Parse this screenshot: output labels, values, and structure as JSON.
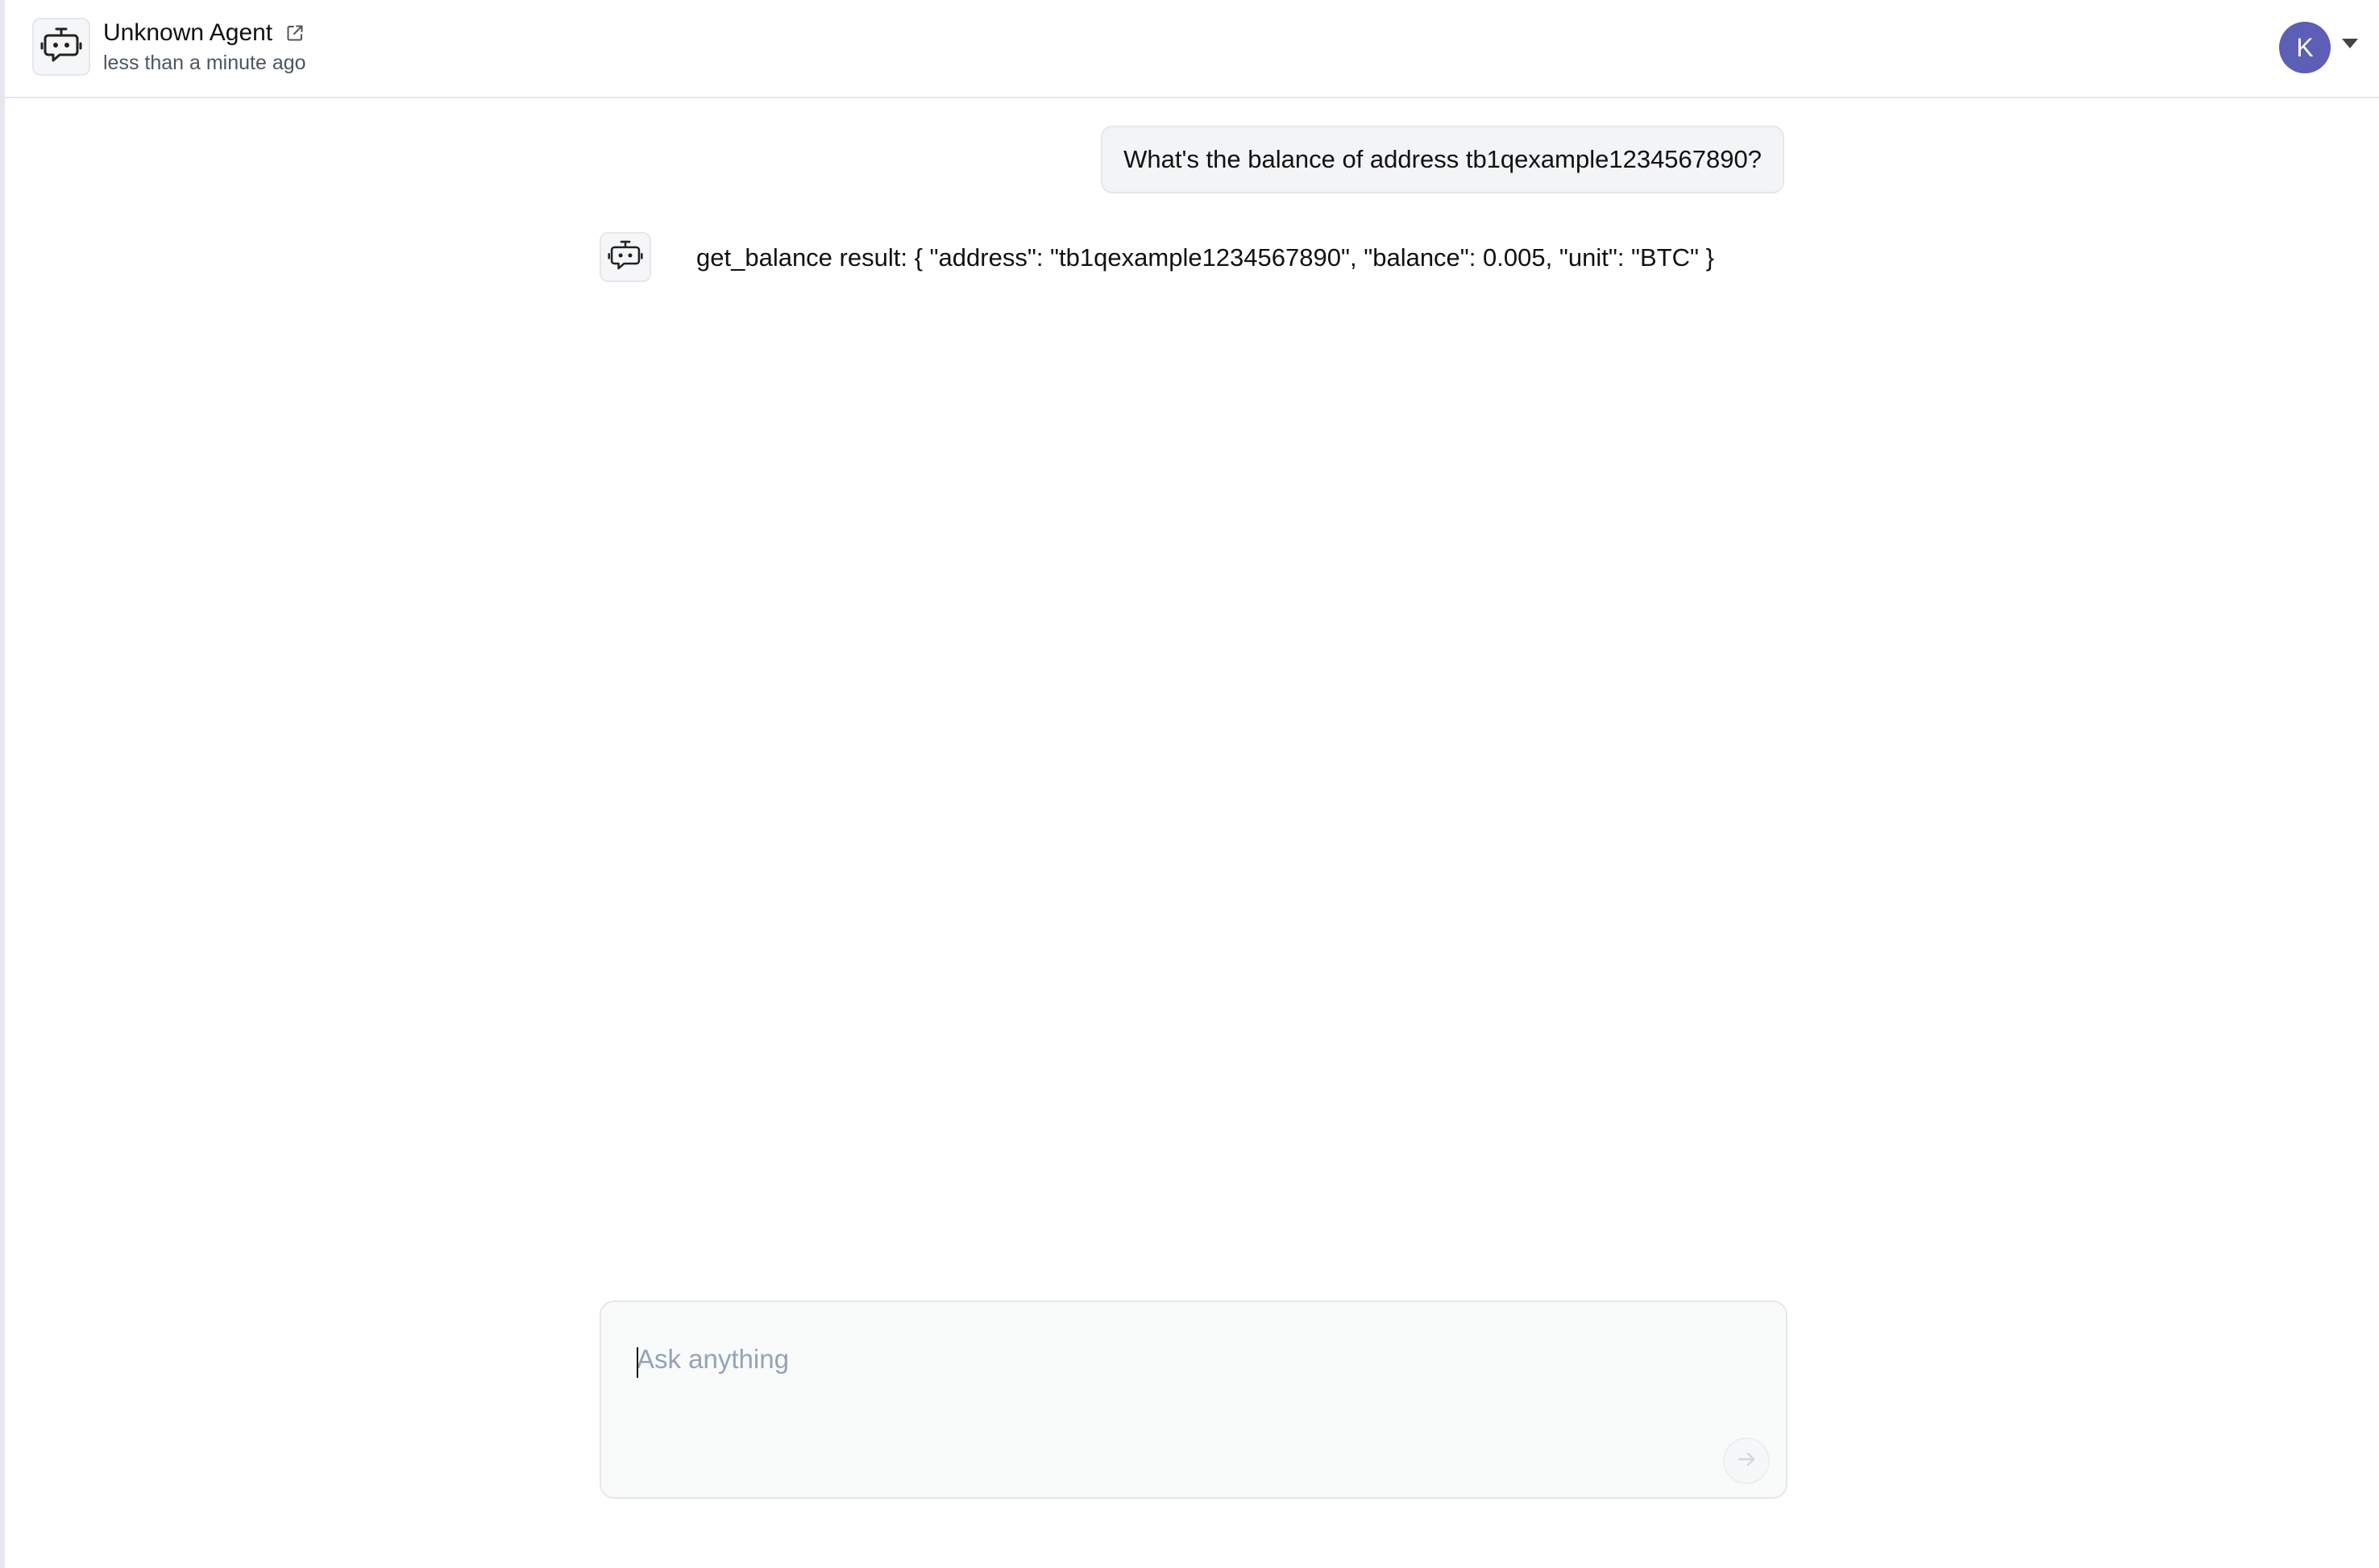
{
  "header": {
    "agent_name": "Unknown Agent",
    "agent_icon": "robot-chat-icon",
    "external_link_icon": "external-link-icon",
    "timestamp": "less than a minute ago",
    "user_initial": "K",
    "user_avatar_color": "#5b5fb5",
    "user_menu_icon": "caret-down-icon"
  },
  "chat": {
    "messages": [
      {
        "role": "user",
        "text": "What's the balance of address tb1qexample1234567890?"
      },
      {
        "role": "assistant",
        "icon": "robot-chat-icon",
        "text": "get_balance result: { \"address\": \"tb1qexample1234567890\", \"balance\": 0.005, \"unit\": \"BTC\" }"
      }
    ]
  },
  "composer": {
    "placeholder": "Ask anything",
    "value": "",
    "send_icon": "arrow-right-icon"
  }
}
